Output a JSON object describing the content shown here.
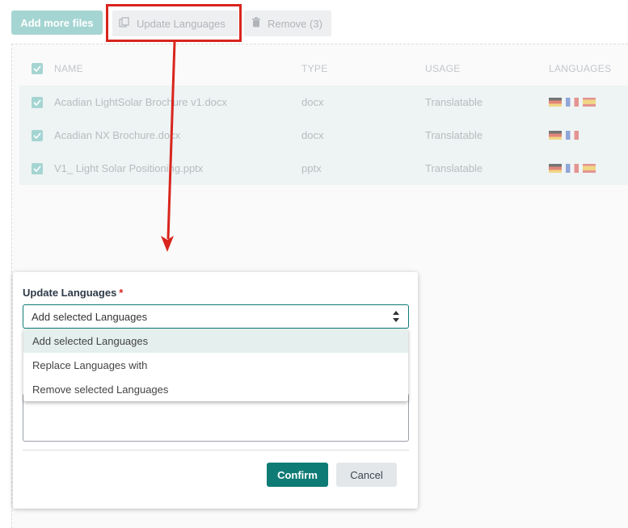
{
  "toolbar": {
    "add_label": "Add more files",
    "update_label": "Update Languages",
    "remove_label": "Remove (3)"
  },
  "table": {
    "columns": [
      "NAME",
      "TYPE",
      "USAGE",
      "LANGUAGES"
    ],
    "rows": [
      {
        "name": "Acadian LightSolar Brochure v1.docx",
        "type": "docx",
        "usage": "Translatable",
        "languages": [
          "de",
          "fr",
          "es"
        ]
      },
      {
        "name": "Acadian NX Brochure.docx",
        "type": "docx",
        "usage": "Translatable",
        "languages": [
          "de",
          "fr"
        ]
      },
      {
        "name": "V1_ Light Solar Positioning.pptx",
        "type": "pptx",
        "usage": "Translatable",
        "languages": [
          "de",
          "fr",
          "es"
        ]
      }
    ]
  },
  "modal": {
    "label": "Update Languages",
    "required_mark": "*",
    "select_value": "Add selected Languages",
    "options": [
      "Add selected Languages",
      "Replace Languages with",
      "Remove selected Languages"
    ],
    "confirm_label": "Confirm",
    "cancel_label": "Cancel"
  },
  "colors": {
    "accent": "#0f7b75",
    "highlight": "#d9251d",
    "disabled_button": "#a5d5d2"
  }
}
